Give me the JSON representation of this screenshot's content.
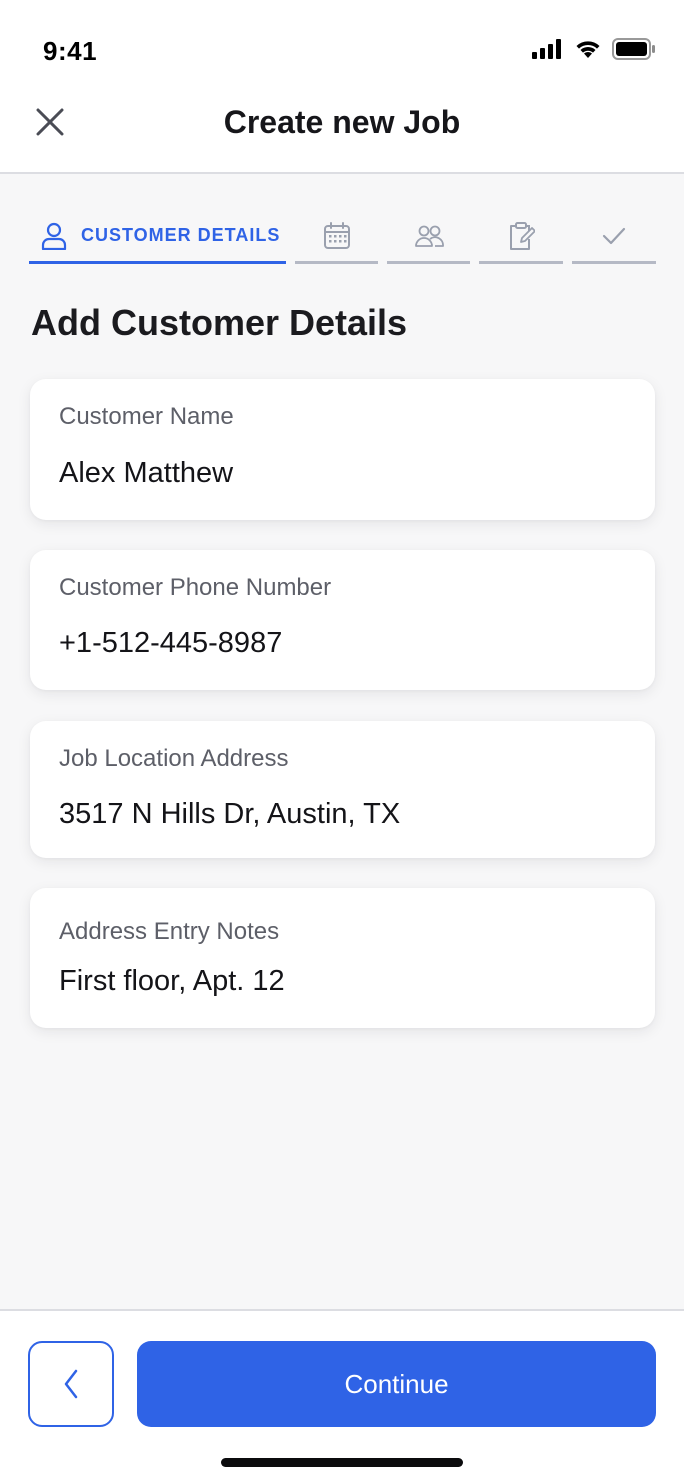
{
  "status_bar": {
    "time": "9:41",
    "icons": [
      "cellular-signal-icon",
      "wifi-icon",
      "battery-icon"
    ]
  },
  "header": {
    "title": "Create new Job",
    "close_icon": "close-icon"
  },
  "stepper": {
    "active_step": 1,
    "steps": [
      {
        "label": "CUSTOMER DETAILS",
        "icon": "user-icon"
      },
      {
        "label": "",
        "icon": "calendar-icon"
      },
      {
        "label": "",
        "icon": "team-icon"
      },
      {
        "label": "",
        "icon": "edit-note-icon"
      },
      {
        "label": "",
        "icon": "check-icon"
      }
    ]
  },
  "section": {
    "title": "Add Customer Details"
  },
  "fields": [
    {
      "label": "Customer Name",
      "value": "Alex Matthew"
    },
    {
      "label": "Customer Phone Number",
      "value": "+1-512-445-8987"
    },
    {
      "label": "Job Location Address",
      "value": "3517 N Hills Dr, Austin, TX"
    },
    {
      "label": "Address Entry Notes",
      "value": "First floor, Apt. 12"
    }
  ],
  "footer": {
    "back_icon": "chevron-left-icon",
    "continue_label": "Continue"
  },
  "colors": {
    "accent": "#2f63e6",
    "inactive_step": "#b5b9c5",
    "background": "#f7f7f8"
  }
}
